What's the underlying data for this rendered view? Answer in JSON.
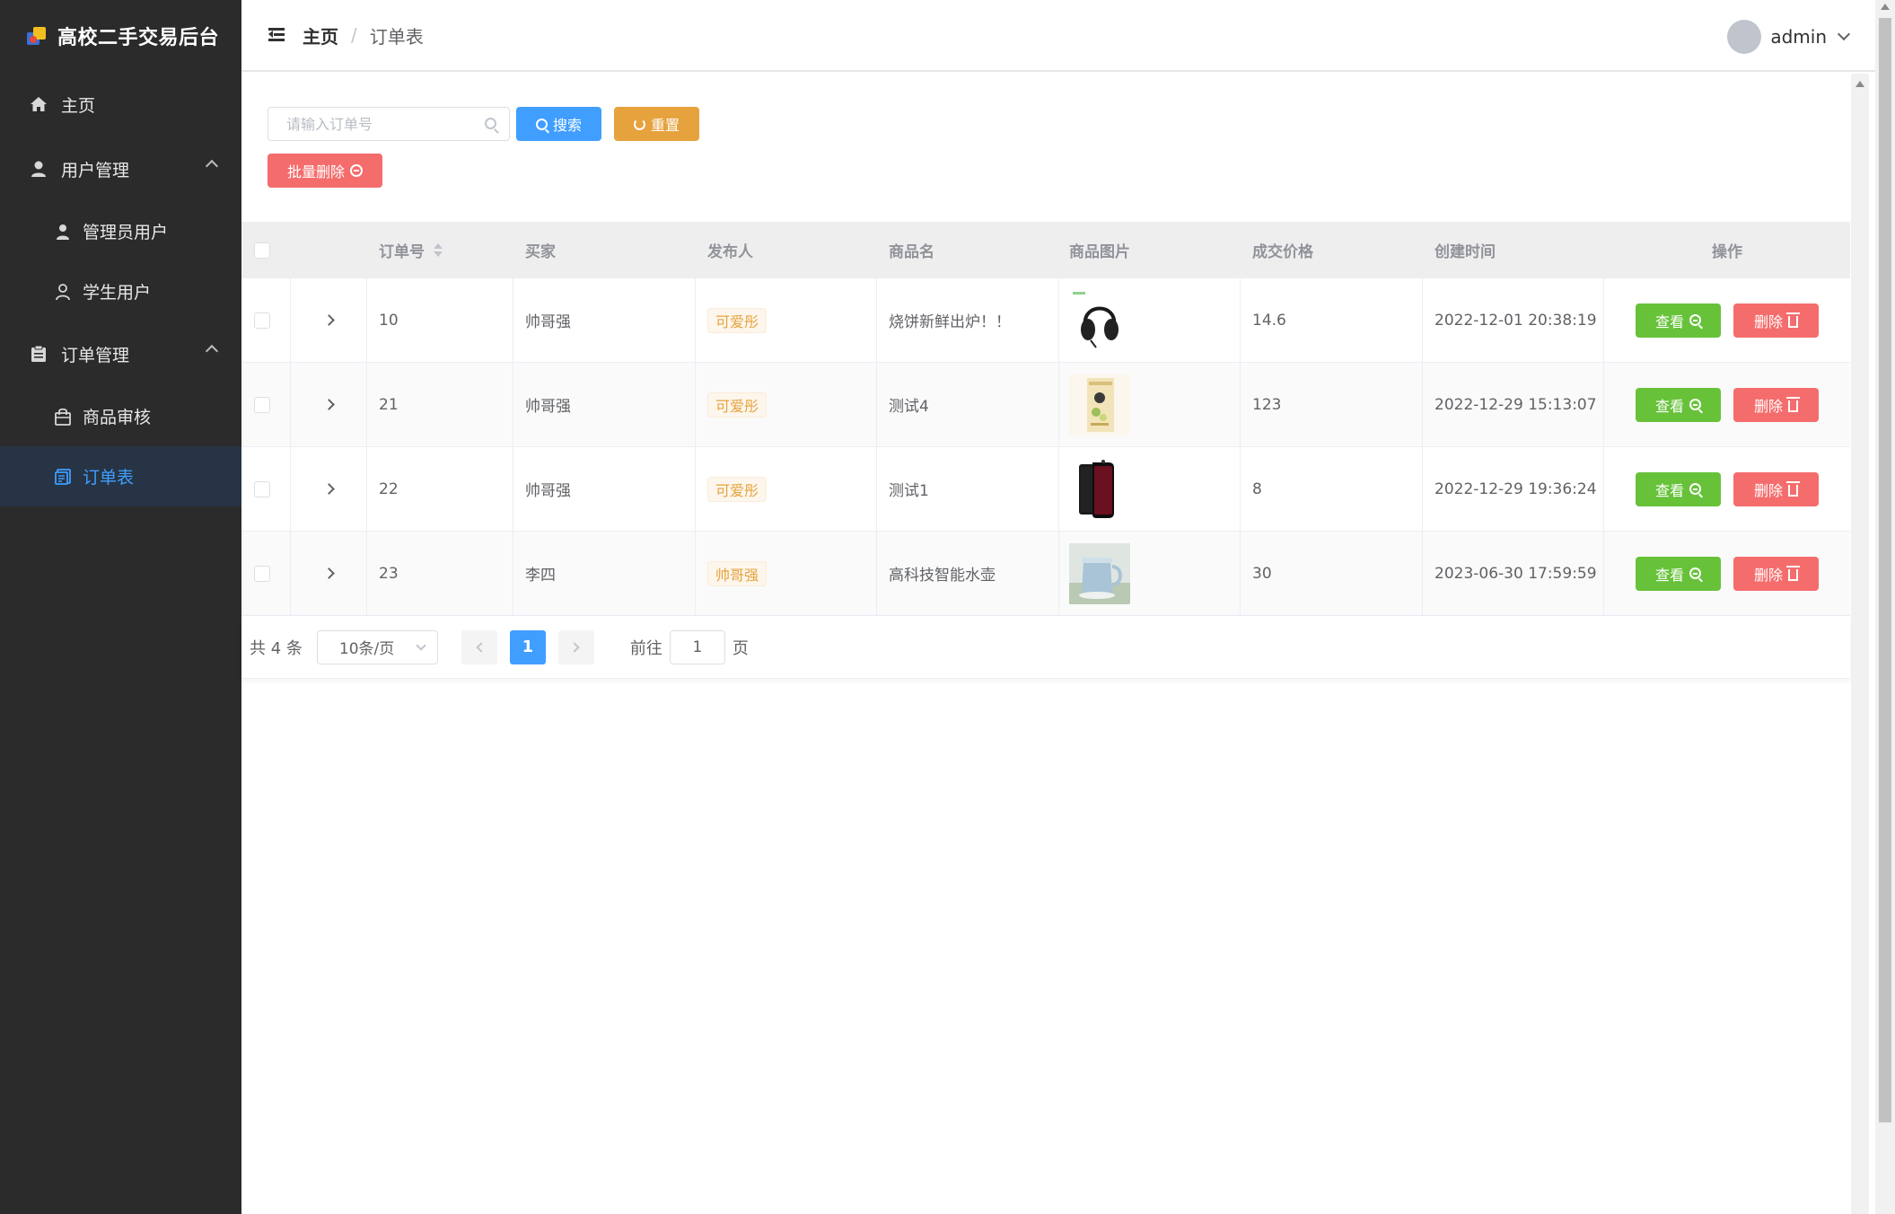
{
  "sidebar": {
    "title": "高校二手交易后台",
    "items": [
      {
        "label": "主页"
      },
      {
        "label": "用户管理",
        "children": [
          {
            "label": "管理员用户"
          },
          {
            "label": "学生用户"
          }
        ]
      },
      {
        "label": "订单管理",
        "children": [
          {
            "label": "商品审核"
          },
          {
            "label": "订单表"
          }
        ]
      }
    ]
  },
  "header": {
    "breadcrumb": [
      "主页",
      "/",
      "订单表"
    ],
    "user": "admin"
  },
  "toolbar": {
    "search_placeholder": "请输入订单号",
    "search_label": "搜索",
    "reset_label": "重置",
    "batch_delete_label": "批量删除"
  },
  "table": {
    "columns": [
      "订单号",
      "买家",
      "发布人",
      "商品名",
      "商品图片",
      "成交价格",
      "创建时间",
      "操作"
    ],
    "rows": [
      {
        "order_no": "10",
        "buyer": "帅哥强",
        "publisher": "可爱彤",
        "product": "烧饼新鲜出炉！！",
        "image": "headphones",
        "price": "14.6",
        "created": "2022-12-01 20:38:19"
      },
      {
        "order_no": "21",
        "buyer": "帅哥强",
        "publisher": "可爱彤",
        "product": "测试4",
        "image": "book",
        "price": "123",
        "created": "2022-12-29 15:13:07"
      },
      {
        "order_no": "22",
        "buyer": "帅哥强",
        "publisher": "可爱彤",
        "product": "测试1",
        "image": "phone",
        "price": "8",
        "created": "2022-12-29 19:36:24"
      },
      {
        "order_no": "23",
        "buyer": "李四",
        "publisher": "帅哥强",
        "product": "高科技智能水壶",
        "image": "kettle",
        "price": "30",
        "created": "2023-06-30 17:59:59"
      }
    ],
    "view_label": "查看",
    "delete_label": "删除"
  },
  "pagination": {
    "total": "共 4 条",
    "page_size": "10条/页",
    "current": "1",
    "goto_prefix": "前往",
    "goto_value": "1",
    "goto_suffix": "页"
  },
  "colors": {
    "sidebar_bg": "#2b2b2b",
    "primary": "#409eff",
    "success": "#67c23a",
    "warning": "#e6a23c",
    "danger": "#f56c6c"
  }
}
